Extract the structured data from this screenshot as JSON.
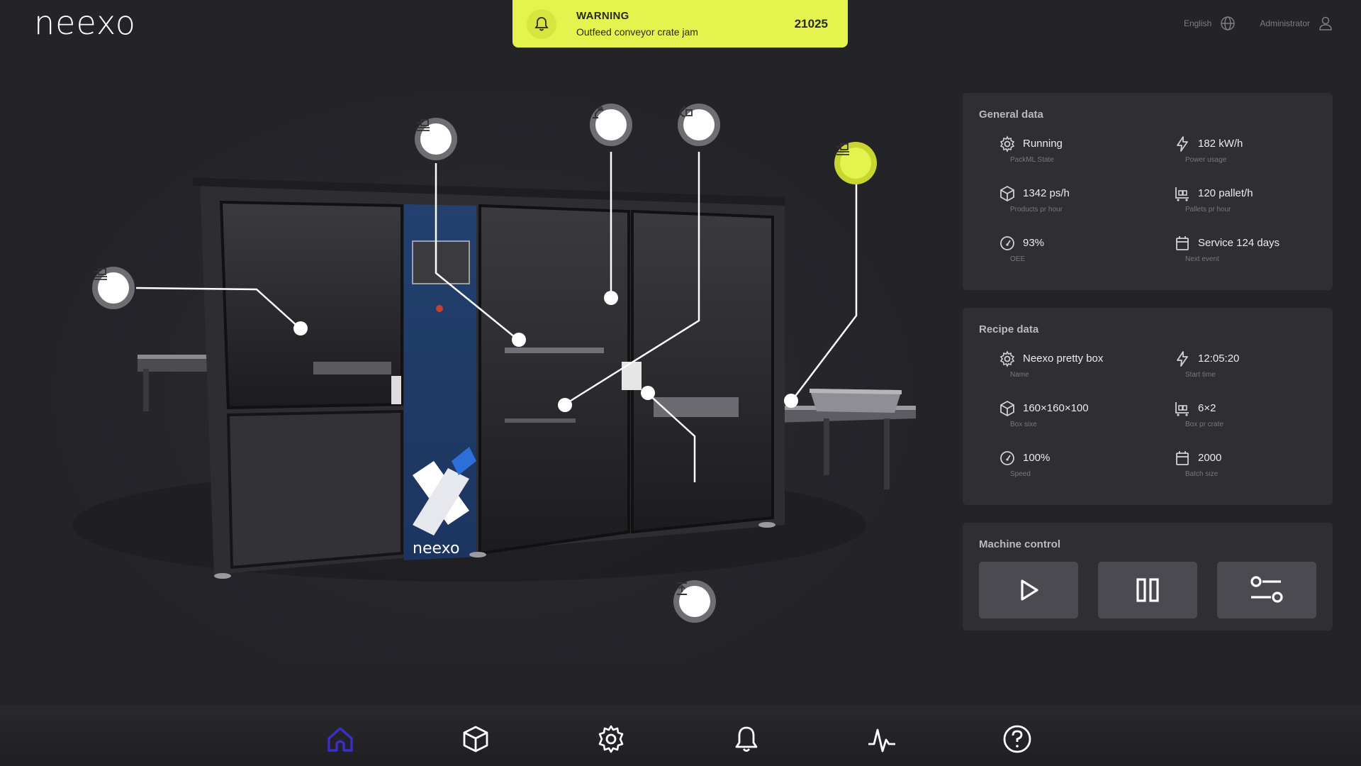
{
  "brand": {
    "logo_text": "neexo"
  },
  "alert": {
    "level": "WARNING",
    "message": "Outfeed conveyor crate jam",
    "code": "21025",
    "icon": "bell-icon",
    "color": "#e4f34e"
  },
  "header": {
    "language": "English",
    "language_icon": "globe-icon",
    "user": "Administrator",
    "user_icon": "user-icon"
  },
  "machine": {
    "cabinet_logo": "neexo",
    "hotspots": [
      {
        "name": "infeed-conveyor",
        "icon": "conveyor-icon",
        "active": false
      },
      {
        "name": "gripper-station",
        "icon": "conveyor-icon",
        "active": false
      },
      {
        "name": "robot-arm",
        "icon": "robot-arm-icon",
        "active": false
      },
      {
        "name": "crate-changer",
        "icon": "swap-crate-icon",
        "active": false
      },
      {
        "name": "outfeed-conveyor",
        "icon": "conveyor-icon",
        "active": true
      },
      {
        "name": "crate-lift",
        "icon": "lift-icon",
        "active": false
      }
    ]
  },
  "general_data": {
    "title": "General data",
    "items": [
      {
        "icon": "gear-icon",
        "value": "Running",
        "label": "PackML State"
      },
      {
        "icon": "lightning-icon",
        "value": "182 kW/h",
        "label": "Power usage"
      },
      {
        "icon": "box-icon",
        "value": "1342 ps/h",
        "label": "Products pr hour"
      },
      {
        "icon": "forklift-icon",
        "value": "120 pallet/h",
        "label": "Pallets pr hour"
      },
      {
        "icon": "gauge-icon",
        "value": "93%",
        "label": "OEE"
      },
      {
        "icon": "calendar-icon",
        "value": "Service 124 days",
        "label": "Next event"
      }
    ]
  },
  "recipe_data": {
    "title": "Recipe data",
    "items": [
      {
        "icon": "gear-icon",
        "value": "Neexo pretty box",
        "label": "Name"
      },
      {
        "icon": "lightning-icon",
        "value": "12:05:20",
        "label": "Start time"
      },
      {
        "icon": "box-icon",
        "value": "160×160×100",
        "label": "Box sixe"
      },
      {
        "icon": "forklift-icon",
        "value": "6×2",
        "label": "Box pr crate"
      },
      {
        "icon": "gauge-icon",
        "value": "100%",
        "label": "Speed"
      },
      {
        "icon": "calendar-icon",
        "value": "2000",
        "label": "Batch size"
      }
    ]
  },
  "machine_control": {
    "title": "Machine control",
    "buttons": [
      {
        "name": "start",
        "icon": "play-icon"
      },
      {
        "name": "pause",
        "icon": "pause-icon"
      },
      {
        "name": "settings",
        "icon": "sliders-icon"
      }
    ]
  },
  "bottom_nav": [
    {
      "name": "home",
      "icon": "home-icon",
      "active": true
    },
    {
      "name": "products",
      "icon": "box-icon",
      "active": false
    },
    {
      "name": "settings",
      "icon": "gear-icon",
      "active": false
    },
    {
      "name": "alarms",
      "icon": "bell-icon",
      "active": false
    },
    {
      "name": "performance",
      "icon": "pulse-icon",
      "active": false
    },
    {
      "name": "help",
      "icon": "help-icon",
      "active": false
    }
  ],
  "colors": {
    "background": "#232328",
    "panel": "#2e2e33",
    "accent": "#e4f34e",
    "nav_active": "#3b2fc9"
  }
}
